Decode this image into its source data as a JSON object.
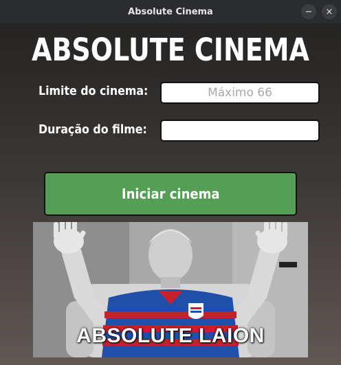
{
  "window": {
    "title": "Absolute Cinema",
    "minimize_glyph": "−",
    "close_glyph": "×"
  },
  "app": {
    "heading": "ABSOLUTE CINEMA",
    "limit_label": "Limite do cinema:",
    "limit_placeholder": "Máximo 66",
    "limit_value": "",
    "duration_label": "Duração do filme:",
    "duration_value": "",
    "start_button": "Iniciar cinema"
  },
  "image": {
    "caption": "ABSOLUTE LAION",
    "jersey_badge": "FORTALEZA"
  },
  "colors": {
    "button_green": "#559e56",
    "jersey_blue": "#1f4fa8",
    "jersey_red": "#c8202b"
  }
}
